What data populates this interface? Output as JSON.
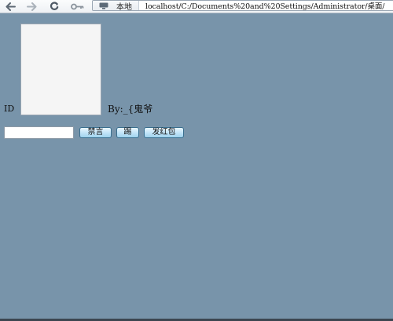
{
  "browser": {
    "scheme_label": "本地",
    "url": "localhost/C:/Documents%20and%20Settings/Administrator/桌面/",
    "icons": {
      "back": "back-arrow-icon",
      "forward": "forward-arrow-icon",
      "reload": "reload-icon",
      "key": "key-icon",
      "scheme": "monitor-icon"
    }
  },
  "page": {
    "id_label": "ID",
    "byline": "By:_{鬼爷",
    "input_value": "",
    "buttons": {
      "ban_label": "禁言",
      "kick_label": "踢",
      "red_packet_label": "发红包"
    }
  },
  "colors": {
    "page_background": "#7894aa",
    "button_gradient_top": "#e9f6ff",
    "button_gradient_bottom": "#9fd2ee",
    "button_border": "#3a6f8f"
  }
}
